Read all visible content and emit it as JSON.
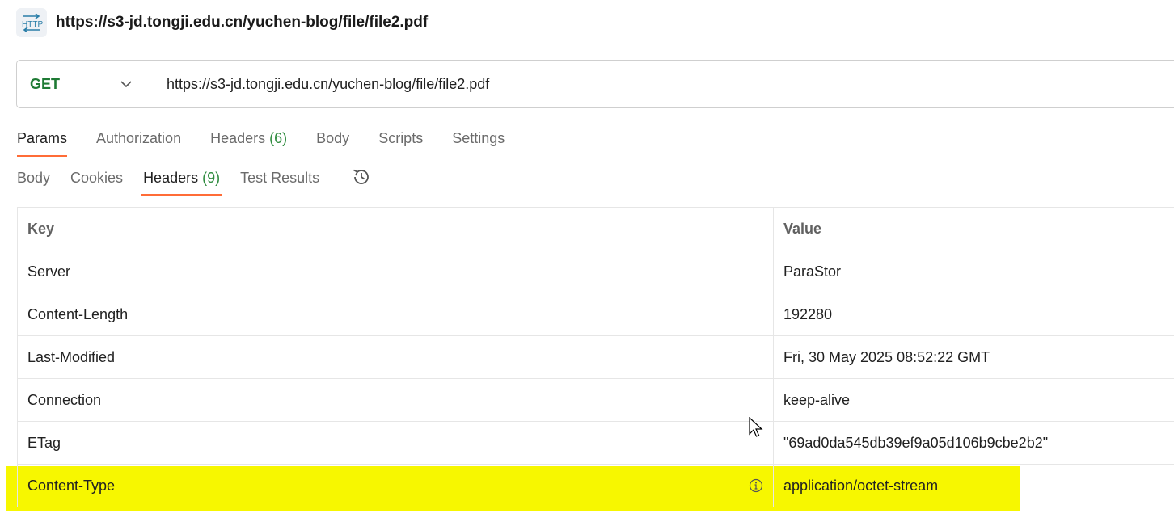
{
  "title": "https://s3-jd.tongji.edu.cn/yuchen-blog/file/file2.pdf",
  "request": {
    "method": "GET",
    "url": "https://s3-jd.tongji.edu.cn/yuchen-blog/file/file2.pdf"
  },
  "request_tabs": {
    "params": "Params",
    "authorization": "Authorization",
    "headers": "Headers",
    "headers_count": "(6)",
    "body": "Body",
    "scripts": "Scripts",
    "settings": "Settings"
  },
  "response_tabs": {
    "body": "Body",
    "cookies": "Cookies",
    "headers": "Headers",
    "headers_count": "(9)",
    "test_results": "Test Results"
  },
  "table": {
    "key_header": "Key",
    "value_header": "Value",
    "rows": [
      {
        "key": "Server",
        "value": "ParaStor"
      },
      {
        "key": "Content-Length",
        "value": "192280"
      },
      {
        "key": "Last-Modified",
        "value": "Fri, 30 May 2025 08:52:22 GMT"
      },
      {
        "key": "Connection",
        "value": "keep-alive"
      },
      {
        "key": "ETag",
        "value": "\"69ad0da545db39ef9a05d106b9cbe2b2\""
      },
      {
        "key": "Content-Type",
        "value": "application/octet-stream"
      }
    ]
  },
  "colors": {
    "accent": "#ff6c37",
    "method_get": "#1e7a34",
    "count": "#2e8b3e",
    "highlight": "#f7f700"
  },
  "icons": {
    "request_icon": "http-icon",
    "method_dropdown": "chevron-down-icon",
    "history": "history-icon",
    "info": "info-icon"
  }
}
